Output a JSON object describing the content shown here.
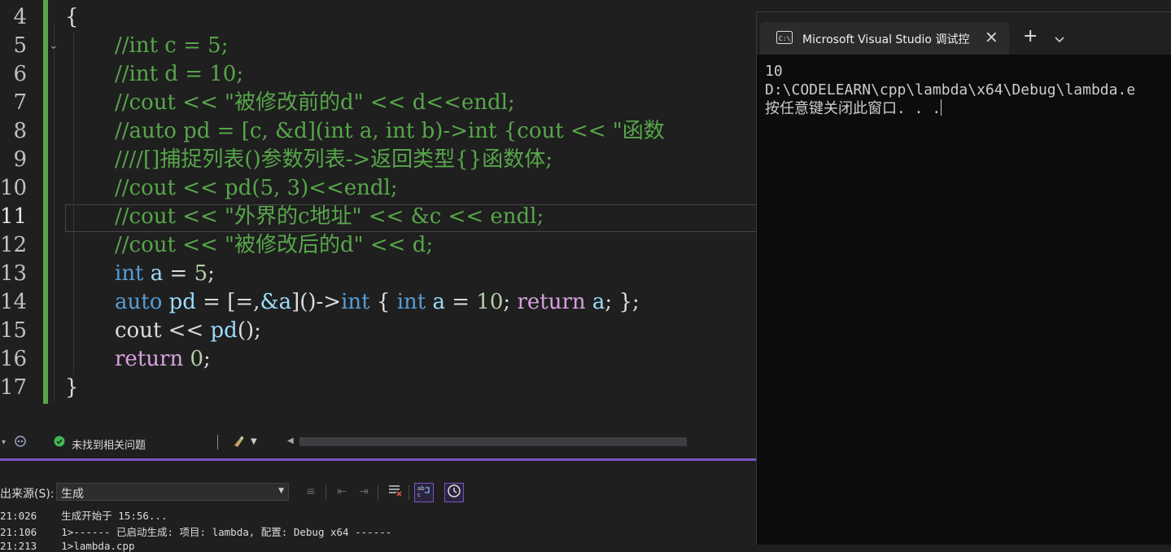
{
  "editor": {
    "line_numbers": [
      "4",
      "5",
      "6",
      "7",
      "8",
      "9",
      "10",
      "11",
      "12",
      "13",
      "14",
      "15",
      "16",
      "17"
    ],
    "lines": {
      "l4": "{",
      "l5": "//int c = 5;",
      "l6": "//int d = 10;",
      "l7": "//cout << \"被修改前的d\" << d<<endl;",
      "l8": "//auto pd = [c, &d](int a, int b)->int {cout << \"函数",
      "l9": "////[]捕捉列表()参数列表->返回类型{}函数体;",
      "l10": "//cout << pd(5, 3)<<endl;",
      "l11": "//cout << \"外界的c地址\" << &c << endl;",
      "l12": "//cout << \"被修改后的d\" << d;",
      "l13": {
        "kw": "int",
        "var": "a",
        "op": " = ",
        "num": "5",
        "end": ";"
      },
      "l14": {
        "t1": "auto",
        "t2": "pd",
        "t3": " = [=,",
        "t4": "&a",
        "t5": "]()->",
        "t6": "int",
        "t7": " { ",
        "t8": "int",
        "t9": "a",
        "t10": " = ",
        "t11": "10",
        "t12": "; ",
        "t13": "return",
        "t14": "a",
        "t15": "; };"
      },
      "l15": {
        "a": "cout",
        "b": " << ",
        "c": "pd",
        "d": "();"
      },
      "l16": {
        "kw": "return",
        "num": "0",
        "end": ";"
      },
      "l17": "}"
    },
    "status": {
      "issues": "未找到相关问题"
    }
  },
  "output": {
    "source_label": "出来源(S):",
    "source_value": "生成",
    "lines": [
      {
        "time": "21:026",
        "text": "生成开始于 15:56..."
      },
      {
        "time": "21:106",
        "text": "1>------ 已启动生成: 项目: lambda, 配置: Debug x64 ------"
      },
      {
        "time": "21:213",
        "text": "1>lambda.cpp"
      }
    ]
  },
  "console": {
    "tab_title": "Microsoft Visual Studio 调试控",
    "lines": [
      "10",
      "D:\\CODELEARN\\cpp\\lambda\\x64\\Debug\\lambda.e",
      "按任意键关闭此窗口. . ."
    ]
  },
  "colors": {
    "comment": "#57a64a",
    "keyword": "#569cd6",
    "control": "#d8a0df",
    "accent": "#7a54c0",
    "console_bg": "#0c0c0c"
  }
}
